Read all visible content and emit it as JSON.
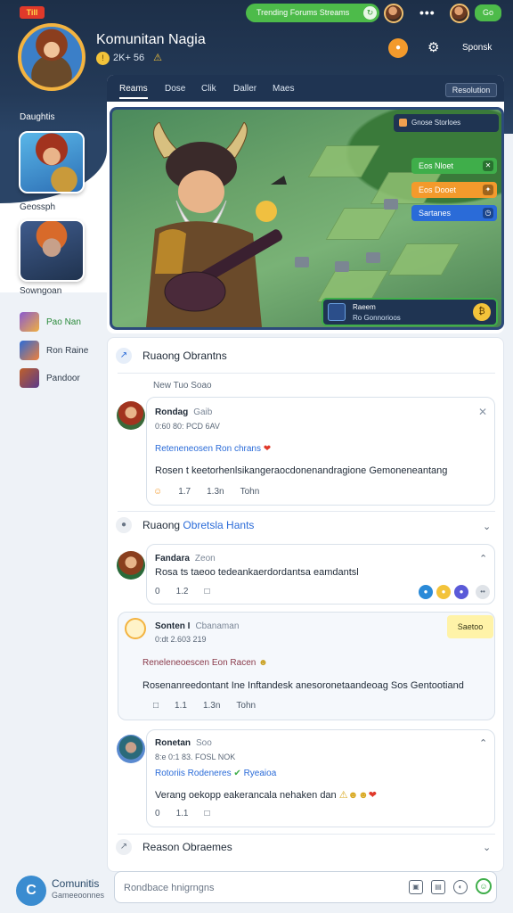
{
  "topbar": {
    "badge": "Till",
    "pill_text": "Trending Forums Streams",
    "dots": "•••",
    "btn_label": "Go"
  },
  "community": {
    "title": "Komunitan Nagia",
    "subtitle": "2K+ 56",
    "settings_label": "Sponsk"
  },
  "left": {
    "section_label": "Daughtis",
    "thumb1_label": "Geossph",
    "thumb2_label": "Sowngoan",
    "mini_items": [
      {
        "label": "Pao Nan",
        "green": true
      },
      {
        "label": "Ron Raine",
        "green": false
      },
      {
        "label": "Pandoor",
        "green": false
      }
    ]
  },
  "tabs": [
    {
      "label": "Reams",
      "active": true
    },
    {
      "label": "Dose"
    },
    {
      "label": "Clik"
    },
    {
      "label": "Daller"
    },
    {
      "label": "Maes"
    }
  ],
  "tab_right": "Resolution",
  "hero": {
    "chip": "Gnose Storloes",
    "side_btns": [
      {
        "label": "Eos Nloet",
        "color": "#3fae4a"
      },
      {
        "label": "Eos Dooet",
        "color": "#f39a2c"
      },
      {
        "label": "Sartanes",
        "color": "#2a6bd8"
      }
    ],
    "now_title": "Raeem",
    "now_sub": "Ro Gonnorioos"
  },
  "feed": {
    "section1": "Ruaong Obrantns",
    "meta": "New   Tuo   Soao",
    "post1": {
      "name": "Rondag",
      "handle": "Gaib",
      "meta": "0:60 80: PCD 6AV",
      "link": "Reteneneosen Ron chrans",
      "text": "Rosen t keetorhenlsikangeraocdonenandragione Gemoneneantang",
      "actions": [
        "1.7",
        "1.3n",
        "Tohn"
      ]
    },
    "section2_pre": "Ruaong ",
    "section2_blue": "Obretsla Hants",
    "post2": {
      "name": "Fandara",
      "handle": "Zeon",
      "text": "Rosa ts taeoo tedeankaerdordantsa eamdantsl",
      "actions": [
        "0",
        "1.2",
        "□"
      ]
    },
    "post3": {
      "name": "Sonten I",
      "handle": "Cbanaman",
      "meta": "0:dt 2.603 219",
      "tag": "Saetoo",
      "link": "Reneleneoescen Eon Racen",
      "text": "Rosenanreedontant Ine Inftandesk anesoronetaandeoag Sos Gentootiand",
      "actions": [
        "□",
        "1.1",
        "1.3n",
        "Tohn"
      ]
    },
    "post4": {
      "name": "Ronetan",
      "handle": "Soo",
      "meta": "8:e 0:1 83. FOSL NOK",
      "link_a": "Rotoriis Rodeneres",
      "link_b": "Ryeaioa",
      "text": "Verang oekopp eakerancala nehaken dan",
      "actions": [
        "0",
        "1.1",
        "□"
      ]
    },
    "section3": "Reason Obraemes"
  },
  "bottom": {
    "brand_title": "Comunitis",
    "brand_sub": "Gameeoonnes",
    "composer_placeholder": "Rondbace hnigrngns"
  },
  "icons": {
    "gear": "gear-icon",
    "send": "smile-send-icon"
  }
}
